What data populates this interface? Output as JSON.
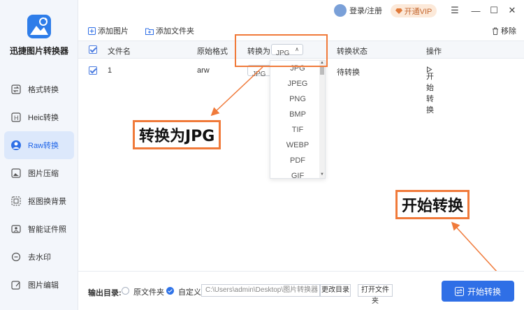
{
  "app": {
    "name": "迅捷图片转换器"
  },
  "titlebar": {
    "login_label": "登录/注册",
    "vip_label": "开通VIP"
  },
  "sidebar": {
    "items": [
      {
        "label": "格式转换",
        "icon": "swap-icon"
      },
      {
        "label": "Heic转换",
        "icon": "heic-icon"
      },
      {
        "label": "Raw转换",
        "icon": "raw-icon",
        "active": true
      },
      {
        "label": "图片压缩",
        "icon": "compress-icon"
      },
      {
        "label": "抠图换背景",
        "icon": "cutout-icon"
      },
      {
        "label": "智能证件照",
        "icon": "id-photo-icon"
      },
      {
        "label": "去水印",
        "icon": "watermark-icon"
      },
      {
        "label": "图片编辑",
        "icon": "edit-icon"
      }
    ]
  },
  "toolbar": {
    "add_image": "添加图片",
    "add_folder": "添加文件夹",
    "remove": "移除"
  },
  "table": {
    "headers": {
      "filename": "文件名",
      "original_format": "原始格式",
      "convert_to": "转换为",
      "convert_to_value": "JPG",
      "status": "转换状态",
      "action": "操作"
    },
    "rows": [
      {
        "filename": "1",
        "format": "arw",
        "target": "JPG",
        "status": "待转换",
        "action": "开始转换"
      }
    ]
  },
  "dropdown": {
    "options": [
      "JPG",
      "JPEG",
      "PNG",
      "BMP",
      "TIF",
      "WEBP",
      "PDF",
      "GIF"
    ]
  },
  "annotations": {
    "convert_to_jpg": "转换为JPG",
    "start_convert": "开始转换"
  },
  "bottom": {
    "output_label": "输出目录:",
    "original_folder": "原文件夹",
    "custom": "自定义",
    "path": "C:\\Users\\admin\\Desktop\\图片转换器",
    "change_dir": "更改目录",
    "open_folder": "打开文件夹",
    "start_button": "开始转换"
  },
  "colors": {
    "accent": "#2f6fe6",
    "highlight": "#f07a3a",
    "sidebar_bg": "#f3f6fb"
  }
}
